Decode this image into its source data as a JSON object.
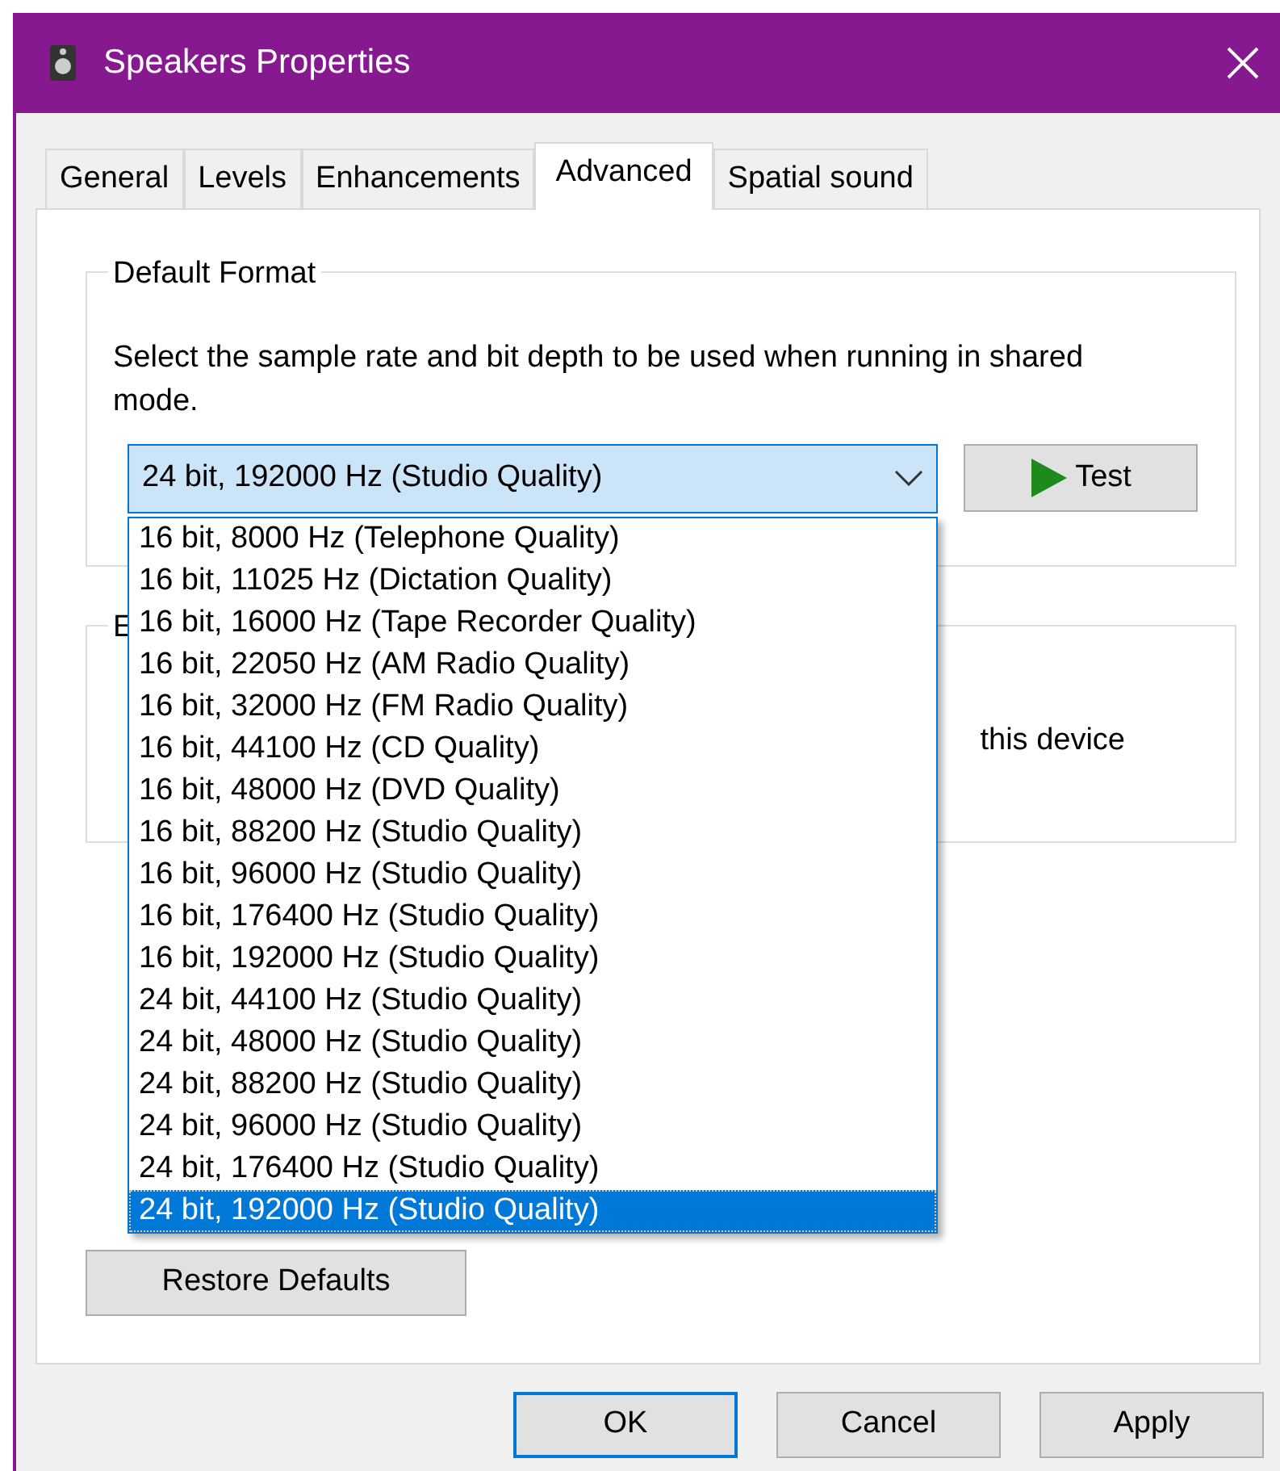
{
  "window": {
    "title": "Speakers Properties"
  },
  "tabs": [
    {
      "label": "General",
      "selected": false
    },
    {
      "label": "Levels",
      "selected": false
    },
    {
      "label": "Enhancements",
      "selected": false
    },
    {
      "label": "Advanced",
      "selected": true
    },
    {
      "label": "Spatial sound",
      "selected": false
    }
  ],
  "default_format": {
    "legend": "Default Format",
    "description": "Select the sample rate and bit depth to be used when running in shared mode.",
    "combo": {
      "value": "24 bit, 192000 Hz (Studio Quality)",
      "expanded": true
    },
    "options": [
      {
        "label": "16 bit, 8000 Hz (Telephone Quality)",
        "selected": false
      },
      {
        "label": "16 bit, 11025 Hz (Dictation Quality)",
        "selected": false
      },
      {
        "label": "16 bit, 16000 Hz (Tape Recorder Quality)",
        "selected": false
      },
      {
        "label": "16 bit, 22050 Hz (AM Radio Quality)",
        "selected": false
      },
      {
        "label": "16 bit, 32000 Hz (FM Radio Quality)",
        "selected": false
      },
      {
        "label": "16 bit, 44100 Hz (CD Quality)",
        "selected": false
      },
      {
        "label": "16 bit, 48000 Hz (DVD Quality)",
        "selected": false
      },
      {
        "label": "16 bit, 88200 Hz (Studio Quality)",
        "selected": false
      },
      {
        "label": "16 bit, 96000 Hz (Studio Quality)",
        "selected": false
      },
      {
        "label": "16 bit, 176400 Hz (Studio Quality)",
        "selected": false
      },
      {
        "label": "16 bit, 192000 Hz (Studio Quality)",
        "selected": false
      },
      {
        "label": "24 bit, 44100 Hz (Studio Quality)",
        "selected": false
      },
      {
        "label": "24 bit, 48000 Hz (Studio Quality)",
        "selected": false
      },
      {
        "label": "24 bit, 88200 Hz (Studio Quality)",
        "selected": false
      },
      {
        "label": "24 bit, 96000 Hz (Studio Quality)",
        "selected": false
      },
      {
        "label": "24 bit, 176400 Hz (Studio Quality)",
        "selected": false
      },
      {
        "label": "24 bit, 192000 Hz (Studio Quality)",
        "selected": true
      }
    ],
    "test_button": "Test"
  },
  "exclusive_group": {
    "legend": "E",
    "text": "this device"
  },
  "restore_button": "Restore Defaults",
  "buttons": [
    {
      "label": "OK",
      "default": true
    },
    {
      "label": "Cancel",
      "default": false
    },
    {
      "label": "Apply",
      "default": false
    }
  ]
}
